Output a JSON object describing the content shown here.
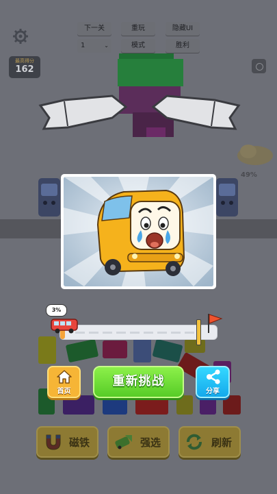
{
  "debug": {
    "next_level": "下一关",
    "replay": "重玩",
    "hide_ui": "隐藏UI",
    "level_select": "1",
    "mode": "模式",
    "win": "胜利"
  },
  "score": {
    "label": "最高得分",
    "value": "162"
  },
  "side_percent": "49%",
  "progress": {
    "percent_text": "3%",
    "fraction": 0.03
  },
  "buttons": {
    "home": "首页",
    "retry": "重新挑战",
    "share": "分享"
  },
  "powerups": [
    {
      "label": "磁铁",
      "icon": "magnet-icon"
    },
    {
      "label": "强选",
      "icon": "force-select-icon"
    },
    {
      "label": "刷新",
      "icon": "refresh-icon"
    }
  ],
  "colors": {
    "retry_green": "#6ddc32",
    "home_orange": "#f6b536",
    "share_blue": "#1fbff5",
    "powerup_gold": "#8d7a33"
  }
}
